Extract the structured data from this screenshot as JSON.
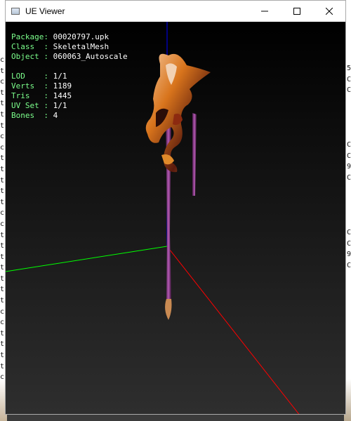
{
  "window": {
    "title": "UE Viewer"
  },
  "info": {
    "group1": [
      {
        "label": "Package",
        "sep": ": ",
        "value": "00020797.upk"
      },
      {
        "label": "Class  ",
        "sep": ": ",
        "value": "SkeletalMesh"
      },
      {
        "label": "Object ",
        "sep": ": ",
        "value": "060063_Autoscale"
      }
    ],
    "group2": [
      {
        "label": "LOD    ",
        "sep": ": ",
        "value": "1/1"
      },
      {
        "label": "Verts  ",
        "sep": ": ",
        "value": "1189"
      },
      {
        "label": "Tris   ",
        "sep": ": ",
        "value": "1445"
      },
      {
        "label": "UV Set ",
        "sep": ": ",
        "value": "1/1"
      },
      {
        "label": "Bones  ",
        "sep": ": ",
        "value": "4"
      }
    ]
  },
  "colors": {
    "axis_x": "#ff0000",
    "axis_y": "#00ff00",
    "axis_z": "#0000ff",
    "info_label": "#7cff8c",
    "info_value": "#ffffff"
  },
  "bg_text_left": "c\nt\nc\nt\nt\nt\nt\nc\nc\nt\nt\nt\nt\nt\nc\nc\nt\nt\nt\nt\nt\nt\nt\nc\nc\nt\nt\nt\nt\nc",
  "bg_text_right": "5\nC\nC\n\n\n\n\nC\nC\n9\nC\n\n\n\n\nC\nC\n9\nC"
}
